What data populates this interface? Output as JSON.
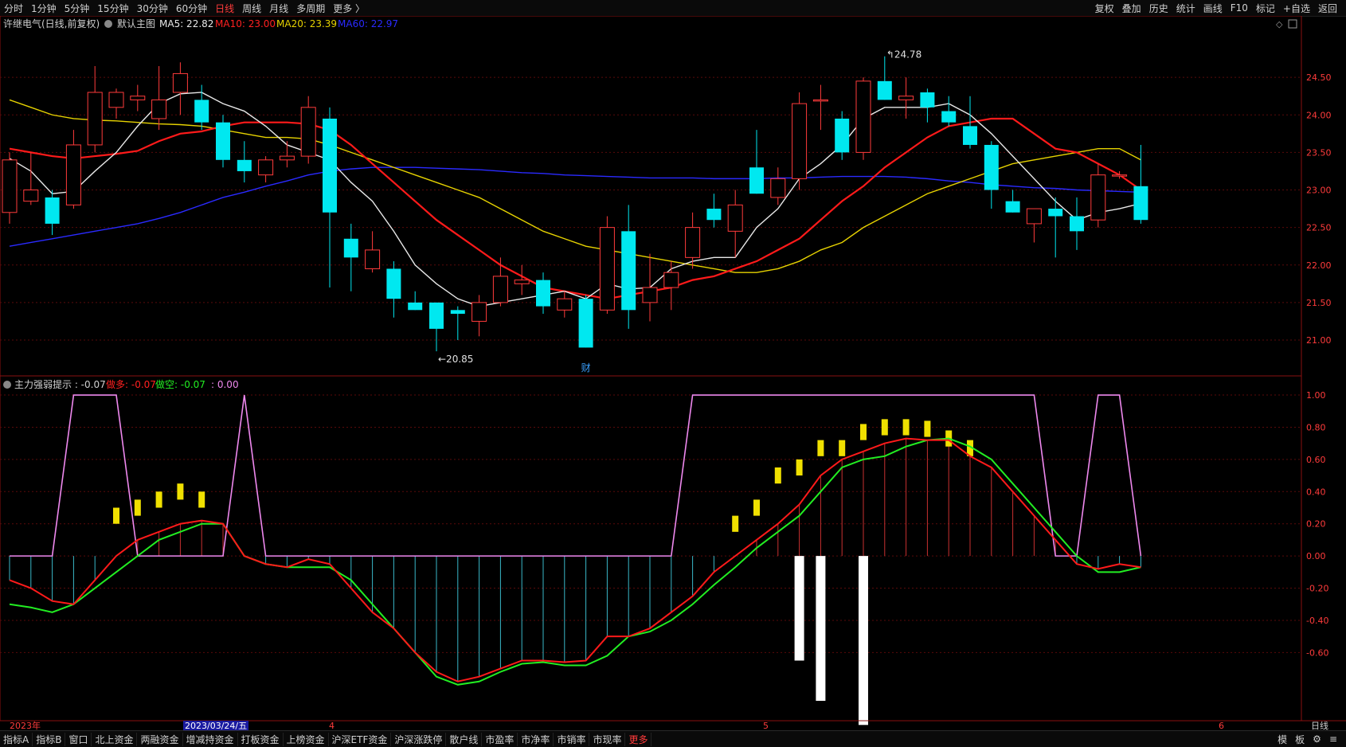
{
  "toolbar": {
    "periods": [
      "分时",
      "1分钟",
      "5分钟",
      "15分钟",
      "30分钟",
      "60分钟",
      "日线",
      "周线",
      "月线",
      "多周期",
      "更多 〉"
    ],
    "active_period": "日线",
    "right_buttons": [
      "复权",
      "叠加",
      "历史",
      "统计",
      "画线",
      "F10",
      "标记",
      "+自选",
      "返回"
    ]
  },
  "bottombar": {
    "tabs": [
      "指标A",
      "指标B",
      "窗口",
      "北上资金",
      "两融资金",
      "增减持资金",
      "打板资金",
      "上榜资金",
      "沪深ETF资金",
      "沪深涨跌停",
      "散户线",
      "市盈率",
      "市净率",
      "市销率",
      "市现率",
      "更多"
    ],
    "right": [
      "模",
      "板",
      "⚙",
      "≡"
    ]
  },
  "main_panel": {
    "title": "许继电气(日线,前复权)",
    "subtitle": "默认主图",
    "ma5_label": "MA5: 22.82",
    "ma10_label": "MA10: 23.00",
    "ma20_label": "MA20: 23.39",
    "ma60_label": "MA60: 22.97",
    "high_label": "24.78",
    "low_label": "20.85",
    "event_marker": "财",
    "colors": {
      "up": "#ff3b3b",
      "down": "#00e8f0",
      "ma5": "#e8e8e8",
      "ma10": "#ff1a1a",
      "ma20": "#e6d200",
      "ma60": "#2a2aff"
    }
  },
  "sub_panel": {
    "title": "主力强弱提示 : -0.07",
    "long_label": "做多: -0.07",
    "short_label": "做空: -0.07",
    "extra_label": ": 0.00",
    "colors": {
      "long": "#ff1a1a",
      "short": "#22ee22",
      "pink": "#ee88ee"
    }
  },
  "date_axis": {
    "labels": [
      "2023年",
      "2023/03/24/五",
      "4",
      "5",
      "6"
    ],
    "period_label": "日线"
  },
  "chart_data": [
    {
      "type": "candlestick",
      "title": "许继电气(日线,前复权)",
      "y_ticks": [
        "24.50",
        "24.00",
        "23.50",
        "23.00",
        "22.50",
        "22.00",
        "21.50",
        "21.00"
      ],
      "ylim": [
        20.65,
        25.0
      ],
      "candles": [
        {
          "o": 22.7,
          "h": 23.5,
          "l": 22.55,
          "c": 23.4
        },
        {
          "o": 22.85,
          "h": 23.5,
          "l": 22.8,
          "c": 23.0
        },
        {
          "o": 22.9,
          "h": 23.0,
          "l": 22.4,
          "c": 22.55
        },
        {
          "o": 22.8,
          "h": 23.8,
          "l": 22.75,
          "c": 23.6
        },
        {
          "o": 23.6,
          "h": 24.65,
          "l": 23.5,
          "c": 24.3
        },
        {
          "o": 24.1,
          "h": 24.35,
          "l": 23.95,
          "c": 24.3
        },
        {
          "o": 24.2,
          "h": 24.4,
          "l": 24.05,
          "c": 24.25
        },
        {
          "o": 23.95,
          "h": 24.65,
          "l": 23.8,
          "c": 24.2
        },
        {
          "o": 24.3,
          "h": 24.7,
          "l": 24.0,
          "c": 24.55
        },
        {
          "o": 24.2,
          "h": 24.4,
          "l": 23.8,
          "c": 23.9
        },
        {
          "o": 23.9,
          "h": 24.0,
          "l": 23.3,
          "c": 23.4
        },
        {
          "o": 23.4,
          "h": 23.65,
          "l": 23.1,
          "c": 23.25
        },
        {
          "o": 23.2,
          "h": 23.45,
          "l": 23.1,
          "c": 23.4
        },
        {
          "o": 23.4,
          "h": 23.65,
          "l": 23.3,
          "c": 23.45
        },
        {
          "o": 23.45,
          "h": 24.25,
          "l": 23.35,
          "c": 24.1
        },
        {
          "o": 23.95,
          "h": 24.1,
          "l": 21.7,
          "c": 22.7
        },
        {
          "o": 22.35,
          "h": 22.55,
          "l": 21.65,
          "c": 22.1
        },
        {
          "o": 21.95,
          "h": 22.45,
          "l": 21.9,
          "c": 22.2
        },
        {
          "o": 21.95,
          "h": 22.05,
          "l": 21.3,
          "c": 21.55
        },
        {
          "o": 21.5,
          "h": 21.65,
          "l": 21.4,
          "c": 21.4
        },
        {
          "o": 21.5,
          "h": 21.5,
          "l": 20.85,
          "c": 21.15
        },
        {
          "o": 21.4,
          "h": 21.45,
          "l": 21.0,
          "c": 21.35
        },
        {
          "o": 21.25,
          "h": 21.6,
          "l": 21.05,
          "c": 21.5
        },
        {
          "o": 21.5,
          "h": 22.1,
          "l": 21.45,
          "c": 21.85
        },
        {
          "o": 21.75,
          "h": 22.0,
          "l": 21.6,
          "c": 21.8
        },
        {
          "o": 21.8,
          "h": 21.9,
          "l": 21.35,
          "c": 21.45
        },
        {
          "o": 21.4,
          "h": 21.65,
          "l": 21.3,
          "c": 21.55
        },
        {
          "o": 21.55,
          "h": 21.6,
          "l": 20.9,
          "c": 20.9
        },
        {
          "o": 21.4,
          "h": 22.65,
          "l": 21.35,
          "c": 22.5
        },
        {
          "o": 22.45,
          "h": 22.8,
          "l": 21.15,
          "c": 21.4
        },
        {
          "o": 21.5,
          "h": 22.15,
          "l": 21.25,
          "c": 21.7
        },
        {
          "o": 21.7,
          "h": 22.05,
          "l": 21.4,
          "c": 21.9
        },
        {
          "o": 22.1,
          "h": 22.7,
          "l": 21.95,
          "c": 22.5
        },
        {
          "o": 22.75,
          "h": 22.95,
          "l": 22.5,
          "c": 22.6
        },
        {
          "o": 22.45,
          "h": 23.0,
          "l": 22.1,
          "c": 22.8
        },
        {
          "o": 23.3,
          "h": 23.8,
          "l": 22.95,
          "c": 22.95
        },
        {
          "o": 22.9,
          "h": 23.3,
          "l": 22.8,
          "c": 23.15
        },
        {
          "o": 23.15,
          "h": 24.3,
          "l": 23.0,
          "c": 24.15
        },
        {
          "o": 24.2,
          "h": 24.4,
          "l": 23.8,
          "c": 24.2
        },
        {
          "o": 23.95,
          "h": 24.05,
          "l": 23.4,
          "c": 23.5
        },
        {
          "o": 23.5,
          "h": 24.5,
          "l": 23.4,
          "c": 24.45
        },
        {
          "o": 24.45,
          "h": 24.78,
          "l": 24.2,
          "c": 24.2
        },
        {
          "o": 24.2,
          "h": 24.5,
          "l": 23.95,
          "c": 24.25
        },
        {
          "o": 24.3,
          "h": 24.35,
          "l": 23.9,
          "c": 24.1
        },
        {
          "o": 24.05,
          "h": 24.25,
          "l": 23.85,
          "c": 23.9
        },
        {
          "o": 23.85,
          "h": 24.25,
          "l": 23.55,
          "c": 23.6
        },
        {
          "o": 23.6,
          "h": 23.65,
          "l": 22.75,
          "c": 23.0
        },
        {
          "o": 22.85,
          "h": 23.0,
          "l": 22.7,
          "c": 22.7
        },
        {
          "o": 22.55,
          "h": 22.75,
          "l": 22.3,
          "c": 22.75
        },
        {
          "o": 22.75,
          "h": 22.9,
          "l": 22.1,
          "c": 22.65
        },
        {
          "o": 22.65,
          "h": 22.9,
          "l": 22.2,
          "c": 22.45
        },
        {
          "o": 22.6,
          "h": 23.35,
          "l": 22.5,
          "c": 23.2
        },
        {
          "o": 23.2,
          "h": 23.25,
          "l": 23.15,
          "c": 23.2
        },
        {
          "o": 23.05,
          "h": 23.6,
          "l": 22.55,
          "c": 22.6
        }
      ],
      "ma5": [
        23.42,
        23.25,
        22.95,
        22.98,
        23.25,
        23.5,
        23.85,
        24.15,
        24.28,
        24.3,
        24.15,
        24.05,
        23.85,
        23.6,
        23.5,
        23.4,
        23.1,
        22.85,
        22.45,
        22.0,
        21.75,
        21.55,
        21.45,
        21.5,
        21.55,
        21.6,
        21.65,
        21.55,
        21.75,
        21.68,
        21.7,
        21.95,
        22.05,
        22.1,
        22.1,
        22.5,
        22.75,
        23.15,
        23.35,
        23.6,
        23.95,
        24.1,
        24.1,
        24.1,
        24.15,
        24.0,
        23.75,
        23.45,
        23.15,
        22.85,
        22.6,
        22.7,
        22.75,
        22.82
      ],
      "ma10": [
        23.55,
        23.5,
        23.45,
        23.42,
        23.45,
        23.48,
        23.52,
        23.65,
        23.75,
        23.78,
        23.85,
        23.9,
        23.9,
        23.9,
        23.88,
        23.8,
        23.6,
        23.35,
        23.1,
        22.85,
        22.6,
        22.4,
        22.2,
        22.0,
        21.85,
        21.7,
        21.65,
        21.6,
        21.55,
        21.6,
        21.65,
        21.7,
        21.8,
        21.85,
        21.95,
        22.05,
        22.2,
        22.35,
        22.6,
        22.85,
        23.05,
        23.3,
        23.5,
        23.7,
        23.85,
        23.9,
        23.95,
        23.95,
        23.75,
        23.55,
        23.5,
        23.35,
        23.2,
        23.0
      ],
      "ma20": [
        24.2,
        24.1,
        24.0,
        23.95,
        23.93,
        23.92,
        23.9,
        23.88,
        23.87,
        23.85,
        23.8,
        23.75,
        23.7,
        23.7,
        23.68,
        23.6,
        23.5,
        23.4,
        23.3,
        23.2,
        23.1,
        23.0,
        22.9,
        22.75,
        22.6,
        22.45,
        22.35,
        22.25,
        22.2,
        22.15,
        22.1,
        22.05,
        22.0,
        21.95,
        21.9,
        21.9,
        21.95,
        22.05,
        22.2,
        22.3,
        22.5,
        22.65,
        22.8,
        22.95,
        23.05,
        23.15,
        23.25,
        23.35,
        23.4,
        23.45,
        23.5,
        23.55,
        23.55,
        23.4
      ],
      "ma60": [
        22.25,
        22.3,
        22.35,
        22.4,
        22.45,
        22.5,
        22.55,
        22.62,
        22.7,
        22.8,
        22.9,
        22.97,
        23.05,
        23.12,
        23.2,
        23.25,
        23.28,
        23.3,
        23.3,
        23.3,
        23.29,
        23.28,
        23.27,
        23.25,
        23.23,
        23.22,
        23.2,
        23.19,
        23.18,
        23.17,
        23.16,
        23.16,
        23.16,
        23.15,
        23.15,
        23.15,
        23.16,
        23.16,
        23.17,
        23.18,
        23.18,
        23.18,
        23.17,
        23.15,
        23.12,
        23.1,
        23.07,
        23.05,
        23.03,
        23.02,
        23.0,
        22.99,
        22.98,
        22.97
      ]
    },
    {
      "type": "line",
      "title": "主力强弱提示",
      "y_ticks": [
        "1.00",
        "0.80",
        "0.60",
        "0.40",
        "0.20",
        "0.00",
        "-0.20",
        "-0.40",
        "-0.60"
      ],
      "ylim": [
        -0.9,
        1.02
      ],
      "long": [
        -0.15,
        -0.2,
        -0.28,
        -0.3,
        -0.15,
        0.0,
        0.1,
        0.15,
        0.2,
        0.22,
        0.2,
        0.0,
        -0.05,
        -0.07,
        -0.02,
        -0.05,
        -0.2,
        -0.35,
        -0.45,
        -0.6,
        -0.72,
        -0.78,
        -0.75,
        -0.7,
        -0.65,
        -0.65,
        -0.66,
        -0.65,
        -0.5,
        -0.5,
        -0.45,
        -0.35,
        -0.25,
        -0.1,
        0.0,
        0.1,
        0.2,
        0.32,
        0.5,
        0.6,
        0.65,
        0.7,
        0.73,
        0.72,
        0.72,
        0.62,
        0.55,
        0.4,
        0.25,
        0.1,
        -0.05,
        -0.08,
        -0.05,
        -0.07
      ],
      "short": [
        -0.3,
        -0.32,
        -0.35,
        -0.3,
        -0.2,
        -0.1,
        0.0,
        0.1,
        0.15,
        0.2,
        0.2,
        0.0,
        -0.05,
        -0.07,
        -0.07,
        -0.07,
        -0.15,
        -0.3,
        -0.45,
        -0.6,
        -0.75,
        -0.8,
        -0.78,
        -0.72,
        -0.67,
        -0.66,
        -0.68,
        -0.68,
        -0.62,
        -0.5,
        -0.47,
        -0.4,
        -0.3,
        -0.18,
        -0.07,
        0.05,
        0.15,
        0.25,
        0.4,
        0.55,
        0.6,
        0.62,
        0.68,
        0.72,
        0.73,
        0.68,
        0.6,
        0.45,
        0.3,
        0.15,
        0.0,
        -0.1,
        -0.1,
        -0.07
      ],
      "pink": [
        0,
        0,
        0,
        1,
        1,
        1,
        0,
        0,
        0,
        0,
        0,
        1,
        0,
        0,
        0,
        0,
        0,
        0,
        0,
        0,
        0,
        0,
        0,
        0,
        0,
        0,
        0,
        0,
        0,
        0,
        0,
        0,
        1,
        1,
        1,
        1,
        1,
        1,
        1,
        1,
        1,
        1,
        1,
        1,
        1,
        1,
        1,
        1,
        1,
        0,
        0,
        1,
        1,
        0
      ],
      "yellow_bars": [
        {
          "i": 5,
          "v": 0.3
        },
        {
          "i": 6,
          "v": 0.35
        },
        {
          "i": 7,
          "v": 0.4
        },
        {
          "i": 8,
          "v": 0.45
        },
        {
          "i": 9,
          "v": 0.4
        },
        {
          "i": 34,
          "v": 0.25
        },
        {
          "i": 35,
          "v": 0.35
        },
        {
          "i": 36,
          "v": 0.55
        },
        {
          "i": 37,
          "v": 0.6
        },
        {
          "i": 38,
          "v": 0.72
        },
        {
          "i": 39,
          "v": 0.72
        },
        {
          "i": 40,
          "v": 0.82
        },
        {
          "i": 41,
          "v": 0.85
        },
        {
          "i": 42,
          "v": 0.85
        },
        {
          "i": 43,
          "v": 0.84
        },
        {
          "i": 44,
          "v": 0.78
        },
        {
          "i": 45,
          "v": 0.72
        }
      ],
      "white_bars": [
        {
          "i": 37,
          "v": -0.65
        },
        {
          "i": 38,
          "v": -0.9
        },
        {
          "i": 40,
          "v": -1.05
        }
      ]
    }
  ]
}
